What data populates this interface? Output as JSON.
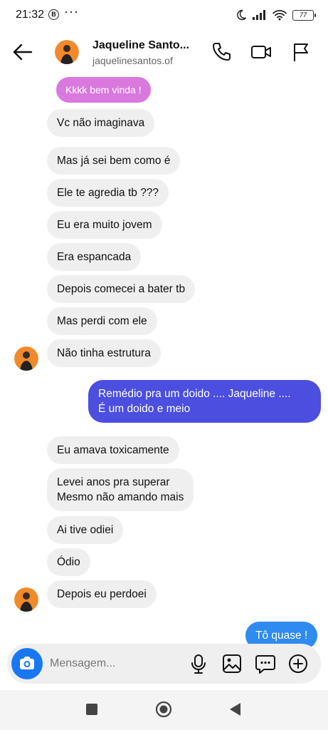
{
  "status_bar": {
    "time": "21:32",
    "bt_badge": "B",
    "dots": "···",
    "battery": "77"
  },
  "header": {
    "name": "Jaqueline Santo...",
    "username": "jaquelinesantos.of",
    "icons": [
      "back-arrow-icon",
      "phone-icon",
      "video-camera-icon",
      "flag-icon"
    ]
  },
  "messages": [
    {
      "id": "m0",
      "from": "other",
      "text": "Kkkk bem vinda !"
    },
    {
      "id": "m1",
      "from": "other",
      "text": "Vc não imaginava"
    },
    {
      "id": "m2",
      "from": "other",
      "text": "Mas já sei bem como é"
    },
    {
      "id": "m3",
      "from": "other",
      "text": "Ele te agredia tb ???"
    },
    {
      "id": "m4",
      "from": "other",
      "text": "Eu era muito jovem"
    },
    {
      "id": "m5",
      "from": "other",
      "text": "Era espancada"
    },
    {
      "id": "m6",
      "from": "other",
      "text": "Depois comecei a bater tb"
    },
    {
      "id": "m7",
      "from": "other",
      "text": "Mas perdi com ele"
    },
    {
      "id": "m8",
      "from": "other",
      "text": "Não tinha estrutura"
    },
    {
      "id": "m9",
      "from": "me",
      "line1": "Remédio pra um doido .... Jaqueline ....",
      "line2": "É um doido e meio"
    },
    {
      "id": "m10",
      "from": "other",
      "text": "Eu amava toxicamente"
    },
    {
      "id": "m11",
      "from": "other",
      "line1": "Levei anos pra superar",
      "line2": "Mesmo não amando mais"
    },
    {
      "id": "m12",
      "from": "other",
      "text": "Ai tive odiei"
    },
    {
      "id": "m13",
      "from": "other",
      "text": "Ódio"
    },
    {
      "id": "m14",
      "from": "other",
      "text": "Depois eu perdoei"
    },
    {
      "id": "m15",
      "from": "me",
      "text": "Tô quase !"
    }
  ],
  "composer": {
    "placeholder": "Mensagem...",
    "icons": [
      "camera-icon",
      "microphone-icon",
      "gallery-icon",
      "sticker-icon",
      "plus-icon"
    ]
  },
  "colors": {
    "accent": "#1877f2",
    "reply_bubble": "#d978dd",
    "outgoing_purple": "#4c4ee0",
    "outgoing_blue": "#2f8bf0",
    "incoming_bubble": "#efefef"
  }
}
